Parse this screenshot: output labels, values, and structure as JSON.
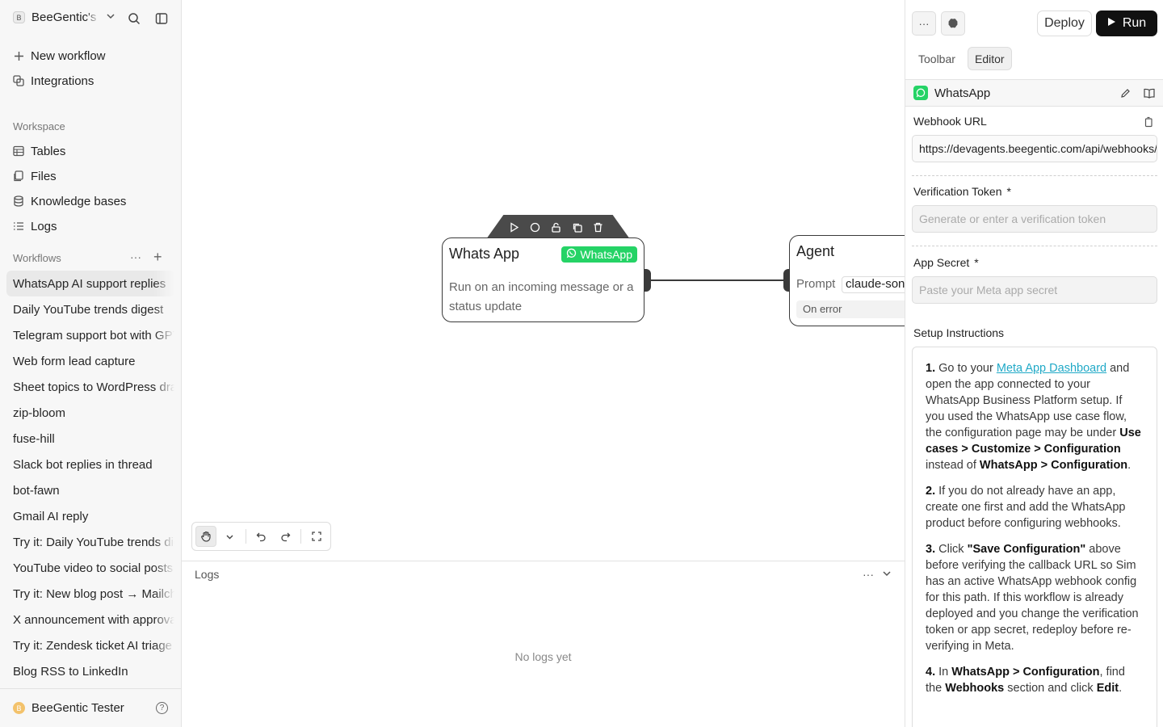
{
  "sidebar": {
    "workspace_badge": "B",
    "workspace_name": "BeeGentic's",
    "new_workflow": "New workflow",
    "integrations": "Integrations",
    "workspace_label": "Workspace",
    "workspace_items": [
      "Tables",
      "Files",
      "Knowledge bases",
      "Logs"
    ],
    "workflows_label": "Workflows",
    "workflows_more": "···",
    "workflows_add": "+",
    "workflows": [
      "WhatsApp AI support replies",
      "Daily YouTube trends digest",
      "Telegram support bot with GPT",
      "Web form lead capture",
      "Sheet topics to WordPress drafts",
      "zip-bloom",
      "fuse-hill",
      "Slack bot replies in thread",
      "bot-fawn",
      "Gmail AI reply",
      "Try it: Daily YouTube trends digest",
      "YouTube video to social posts",
      "Try it: New blog post → Mailchimp",
      "X announcement with approval",
      "Try it: Zendesk ticket AI triage",
      "Blog RSS to LinkedIn"
    ],
    "active_workflow_index": 0,
    "user_avatar": "B",
    "user_name": "BeeGentic Tester"
  },
  "canvas": {
    "trigger_node": {
      "title": "Whats App",
      "badge": "WhatsApp",
      "description": "Run on an incoming message or a status update"
    },
    "agent_node": {
      "title": "Agent",
      "prompt_label": "Prompt",
      "prompt_value": "claude-sonnet",
      "on_error": "On error"
    }
  },
  "logs": {
    "title": "Logs",
    "more": "···",
    "empty": "No logs yet"
  },
  "panel": {
    "more_btn": "···",
    "deploy": "Deploy",
    "run": "Run",
    "tabs": [
      "Toolbar",
      "Editor"
    ],
    "active_tab": "Editor",
    "block_name": "WhatsApp",
    "webhook_label": "Webhook URL",
    "webhook_value": "https://devagents.beegentic.com/api/webhooks/trigger",
    "token_label": "Verification Token",
    "token_placeholder": "Generate or enter a verification token",
    "secret_label": "App Secret",
    "secret_placeholder": "Paste your Meta app secret",
    "required_mark": "*",
    "instructions_label": "Setup Instructions",
    "instructions": {
      "s1_num": "1.",
      "s1_a": " Go to your ",
      "s1_link": "Meta App Dashboard",
      "s1_b": " and open the app connected to your WhatsApp Business Platform setup. If you used the WhatsApp use case flow, the configuration page may be under ",
      "s1_bold1": "Use cases > Customize > Configuration",
      "s1_c": " instead of ",
      "s1_bold2": "WhatsApp > Configuration",
      "s1_d": ".",
      "s2_num": "2.",
      "s2_a": " If you do not already have an app, create one first and add the WhatsApp product before configuring webhooks.",
      "s3_num": "3.",
      "s3_a": " Click ",
      "s3_bold": "\"Save Configuration\"",
      "s3_b": " above before verifying the callback URL so Sim has an active WhatsApp webhook config for this path. If this workflow is already deployed and you change the verification token or app secret, redeploy before re-verifying in Meta.",
      "s4_num": "4.",
      "s4_a": " In ",
      "s4_bold1": "WhatsApp > Configuration",
      "s4_b": ", find the ",
      "s4_bold2": "Webhooks",
      "s4_c": " section and click ",
      "s4_bold3": "Edit",
      "s4_d": "."
    }
  }
}
